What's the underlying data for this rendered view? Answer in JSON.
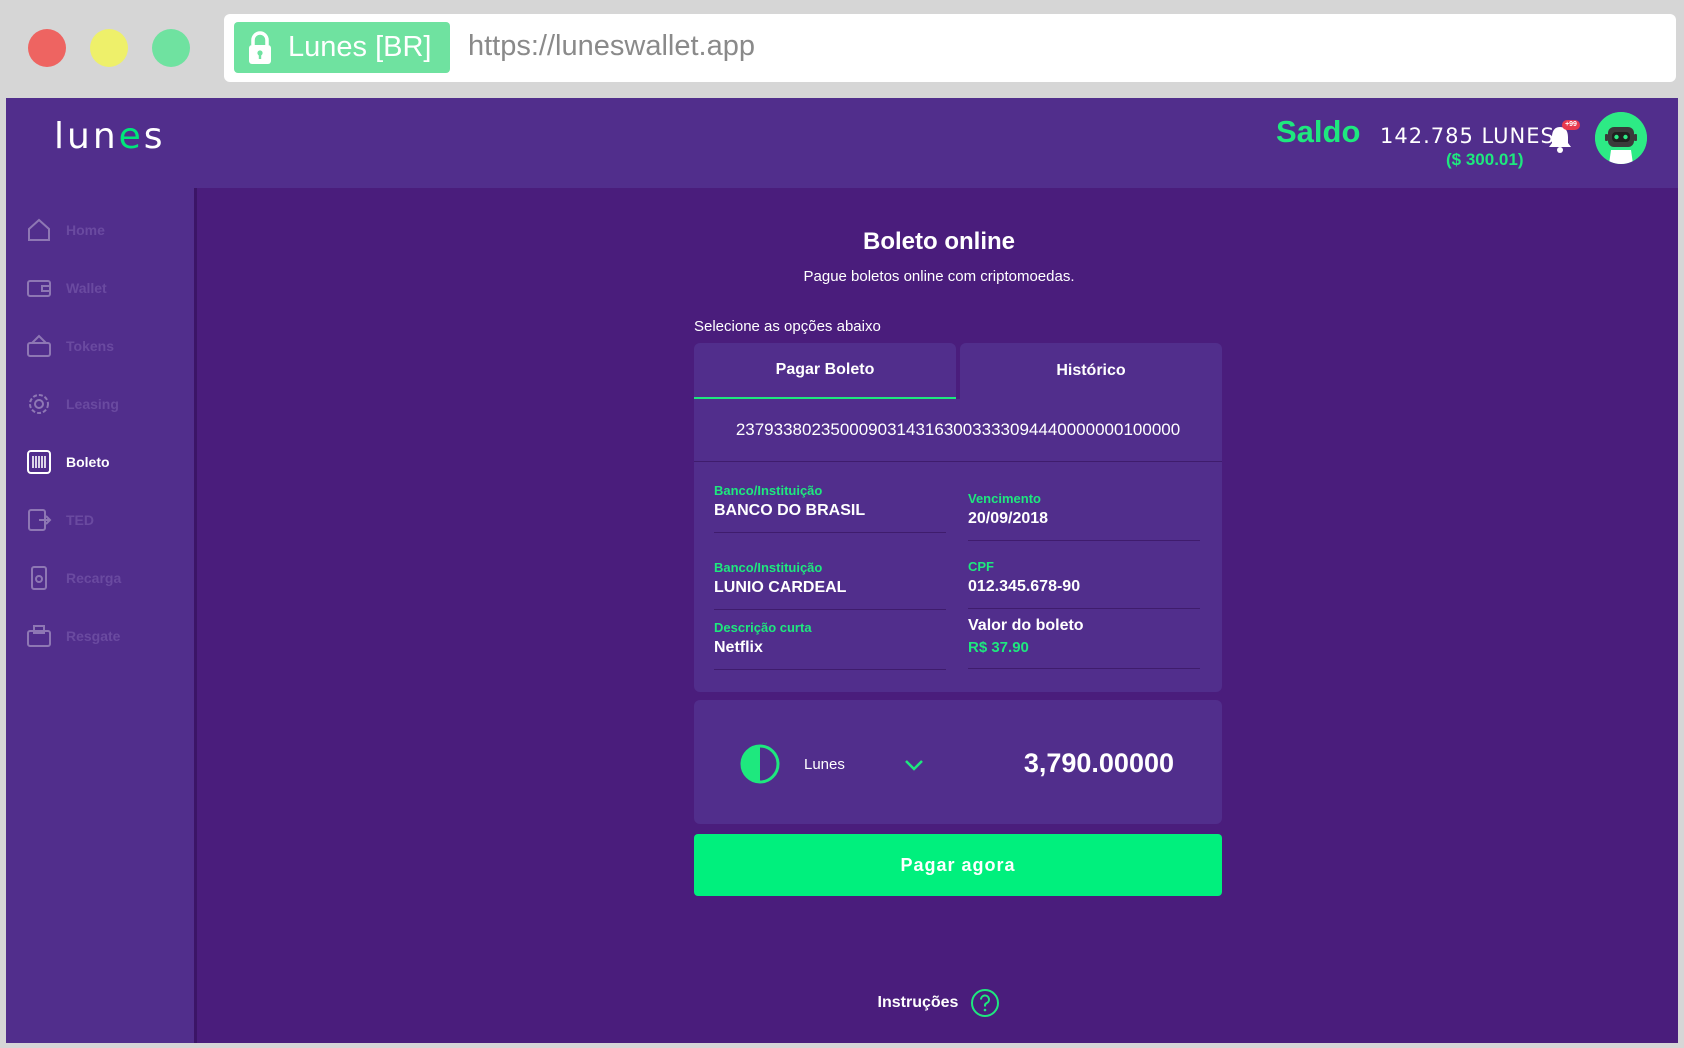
{
  "browser": {
    "site_label": "Lunes [BR]",
    "url": "https://luneswallet.app"
  },
  "header": {
    "logo_prefix": "lun",
    "logo_accent": "e",
    "logo_suffix": "s",
    "saldo_label": "Saldo",
    "balance": "142.785 LUNES",
    "balance_usd": "($ 300.01)",
    "notification_count": "+99"
  },
  "sidebar": {
    "items": [
      {
        "label": "Home",
        "icon": "home-icon"
      },
      {
        "label": "Wallet",
        "icon": "wallet-icon"
      },
      {
        "label": "Tokens",
        "icon": "tokens-icon"
      },
      {
        "label": "Leasing",
        "icon": "leasing-icon"
      },
      {
        "label": "Boleto",
        "icon": "barcode-icon",
        "active": true
      },
      {
        "label": "TED",
        "icon": "ted-icon"
      },
      {
        "label": "Recarga",
        "icon": "recharge-icon"
      },
      {
        "label": "Resgate",
        "icon": "redeem-icon"
      }
    ]
  },
  "main": {
    "title": "Boleto online",
    "subtitle": "Pague boletos online com criptomoedas.",
    "select_label": "Selecione as opções abaixo",
    "tabs": [
      {
        "label": "Pagar Boleto",
        "active": true
      },
      {
        "label": "Histórico",
        "active": false
      }
    ],
    "barcode": "23793380235000903143163003333094440000000100000",
    "fields": {
      "bank_label": "Banco/Instituição",
      "bank_value": "BANCO DO BRASIL",
      "due_label": "Vencimento",
      "due_value": "20/09/2018",
      "payee_label": "Banco/Instituição",
      "payee_value": "LUNIO CARDEAL",
      "cpf_label": "CPF",
      "cpf_value": "012.345.678-90",
      "desc_label": "Descrição curta",
      "desc_value": "Netflix",
      "amount_label": "Valor do boleto",
      "amount_value": "R$ 37.90"
    },
    "coin": {
      "name": "Lunes",
      "amount": "3,790.00000"
    },
    "pay_button": "Pagar agora",
    "instructions": "Instruções"
  },
  "colors": {
    "accent_green": "#1ee87e",
    "button_green": "#00f07d",
    "background_purple": "#4a1d7c",
    "panel_purple": "#512e8c"
  }
}
